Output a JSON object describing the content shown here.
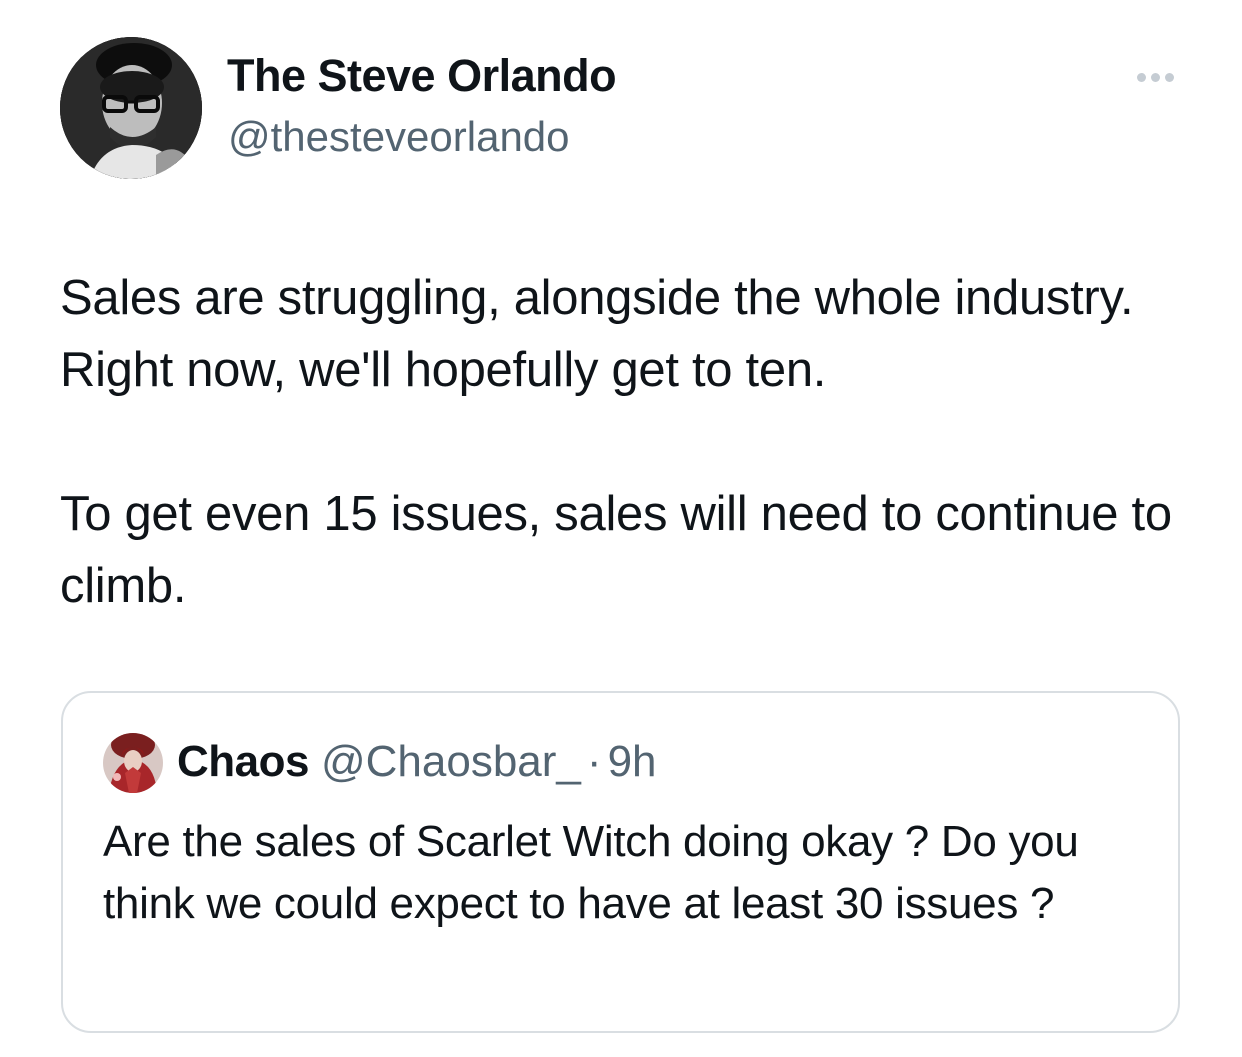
{
  "author": {
    "display_name": "The Steve Orlando",
    "handle": "@thesteveorlando",
    "avatar_icon": "profile-photo"
  },
  "more_menu": {
    "icon": "more-horizontal-icon"
  },
  "tweet": {
    "paragraphs": [
      "Sales are struggling, alongside the whole industry. Right now, we'll hopefully get to ten.",
      "To get even 15 issues, sales will need to continue to climb."
    ]
  },
  "quoted_tweet": {
    "display_name": "Chaos",
    "handle": "@Chaosbar_",
    "separator": "·",
    "time": "9h",
    "text": "Are the sales of Scarlet Witch doing okay ? Do you think we could expect to have at least 30 issues ?",
    "avatar_icon": "profile-photo"
  },
  "colors": {
    "text_primary": "#0f1419",
    "text_secondary": "#536471",
    "border": "#d9dee2",
    "more_dots": "#c5ccd3"
  }
}
